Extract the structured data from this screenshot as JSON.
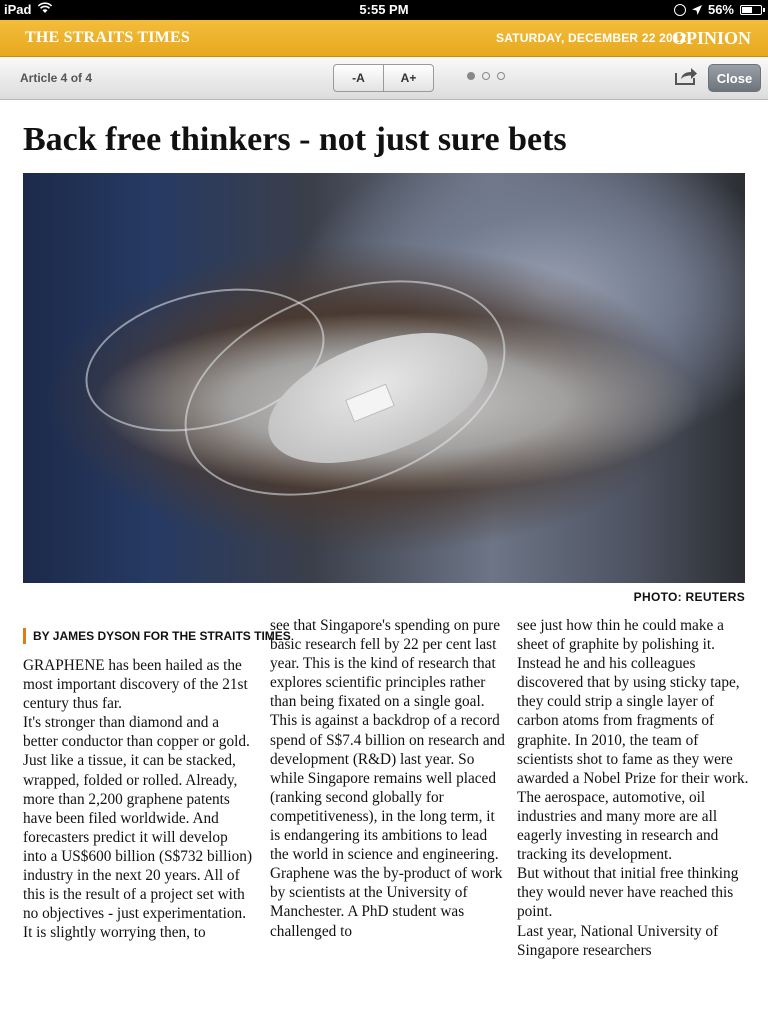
{
  "status_bar": {
    "device": "iPad",
    "time": "5:55 PM",
    "battery": "56%",
    "battery_level": 0.56
  },
  "masthead": {
    "paper": "THE STRAITS TIMES",
    "date": "SATURDAY, DECEMBER 22 2012",
    "section": "OPINION",
    "color": "#f0b429"
  },
  "toolbar": {
    "counter": "Article 4 of 4",
    "font_smaller": "-A",
    "font_larger": "A+",
    "page_dots": 3,
    "active_dot": 0,
    "close_label": "Close"
  },
  "article": {
    "headline": "Back free thinkers - not just sure bets",
    "photo_credit": "PHOTO: REUTERS",
    "byline": "BY JAMES DYSON FOR THE STRAITS TIMES",
    "accent_color": "#e07b1a",
    "columns": [
      [
        "GRAPHENE has been hailed as the most important discovery of the 21st century thus far.",
        " It's stronger than diamond and a better conductor than copper or gold. Just like a tissue, it can be stacked, wrapped, folded or rolled. Already, more than 2,200 graphene patents have been filed worldwide. And forecasters predict it will develop into a US$600 billion (S$732 billion) industry in the next 20 years. All of this is the result of a project set with no objectives - just experimentation.",
        " It is slightly worrying then, to"
      ],
      [
        "see that Singapore's spending on pure basic research fell by 22 per cent last year. This is the kind of research that explores scientific principles rather than being fixated on a single goal. This is against a backdrop of a record spend of S$7.4 billion on research and development (R&D) last year. So while Singapore remains well placed (ranking second globally for competitiveness), in the long term, it is endangering its ambitions to lead the world in science and engineering.",
        " Graphene was the by-product of work by scientists at the University of Manchester. A PhD student was challenged to"
      ],
      [
        "see just how thin he could make a sheet of graphite by polishing it.",
        " Instead he and his colleagues discovered that by using sticky tape, they could strip a single layer of carbon atoms from fragments of graphite. In 2010, the team of scientists shot to fame as they were awarded a Nobel Prize for their work.",
        " The aerospace, automotive, oil industries and many more are all eagerly investing in research and tracking its development.",
        " But without that initial free thinking they would never have reached this point.",
        " Last year, National University of Singapore researchers"
      ]
    ]
  }
}
